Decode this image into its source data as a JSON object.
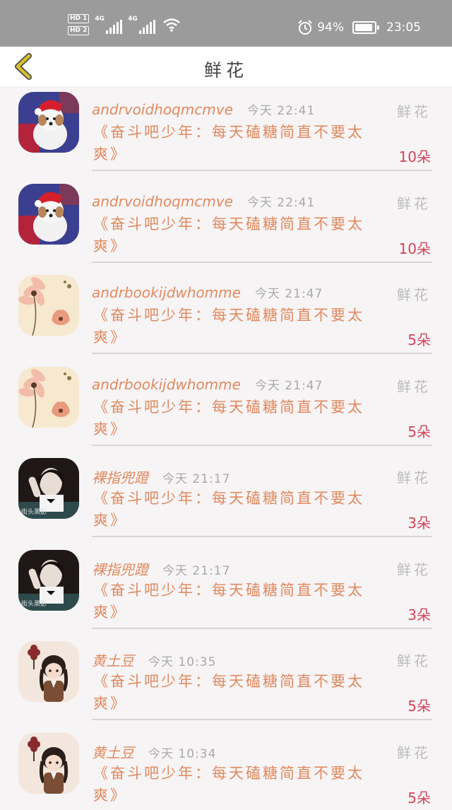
{
  "status_bar": {
    "hd1": "HD 1",
    "hd2": "HD 2",
    "net1": "4G",
    "net2": "4G",
    "battery": "94%",
    "battery_level": 0.94,
    "time": "23:05"
  },
  "header": {
    "back_icon": "chevron-left-icon",
    "title": "鲜花"
  },
  "colors": {
    "username": "#e08a5f",
    "message": "#e08a5f",
    "quantity": "#d2455a",
    "back_icon": "#d9bf2c"
  },
  "items": [
    {
      "avatar": "dog-santa",
      "user": "andrvoidhoqmcmve",
      "time": "今天 22:41",
      "type": "鲜花",
      "message": "《奋斗吧少年：每天磕糖简直不要太爽》",
      "quantity": "10朵"
    },
    {
      "avatar": "dog-santa",
      "user": "andrvoidhoqmcmve",
      "time": "今天 22:41",
      "type": "鲜花",
      "message": "《奋斗吧少年：每天磕糖简直不要太爽》",
      "quantity": "10朵"
    },
    {
      "avatar": "flowers",
      "user": "andrbookijdwhomme",
      "time": "今天 21:47",
      "type": "鲜花",
      "message": "《奋斗吧少年：每天磕糖简直不要太爽》",
      "quantity": "5朵"
    },
    {
      "avatar": "flowers",
      "user": "andrbookijdwhomme",
      "time": "今天 21:47",
      "type": "鲜花",
      "message": "《奋斗吧少年：每天磕糖简直不要太爽》",
      "quantity": "5朵"
    },
    {
      "avatar": "girl-dark",
      "user": "裸指兜蹬",
      "time": "今天 21:17",
      "type": "鲜花",
      "message": "《奋斗吧少年：每天磕糖简直不要太爽》",
      "quantity": "3朵"
    },
    {
      "avatar": "girl-dark",
      "user": "裸指兜蹬",
      "time": "今天 21:17",
      "type": "鲜花",
      "message": "《奋斗吧少年：每天磕糖简直不要太爽》",
      "quantity": "3朵"
    },
    {
      "avatar": "cartoon-girl",
      "user": "黄土豆",
      "time": "今天 10:35",
      "type": "鲜花",
      "message": "《奋斗吧少年：每天磕糖简直不要太爽》",
      "quantity": "5朵"
    },
    {
      "avatar": "cartoon-girl",
      "user": "黄土豆",
      "time": "今天 10:34",
      "type": "鲜花",
      "message": "《奋斗吧少年：每天磕糖简直不要太爽》",
      "quantity": "5朵"
    }
  ]
}
